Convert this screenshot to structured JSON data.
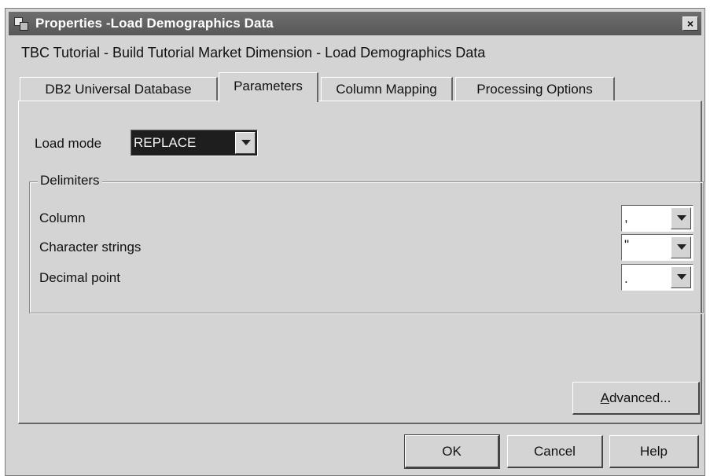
{
  "window": {
    "title": "Properties -Load Demographics Data",
    "close_glyph": "×",
    "subtitle": "TBC Tutorial - Build Tutorial Market Dimension - Load Demographics Data"
  },
  "tabs": [
    {
      "label": "DB2 Universal Database",
      "active": false
    },
    {
      "label": "Parameters",
      "active": true
    },
    {
      "label": "Column Mapping",
      "active": false
    },
    {
      "label": "Processing Options",
      "active": false
    }
  ],
  "parameters": {
    "load_mode_label": "Load mode",
    "load_mode_value": "REPLACE",
    "delimiters": {
      "title": "Delimiters",
      "column_label": "Column",
      "column_value": ",",
      "character_strings_label": "Character strings",
      "character_strings_value": "\"",
      "decimal_point_label": "Decimal point",
      "decimal_point_value": "."
    },
    "advanced_label_prefix": "",
    "advanced_label_access": "A",
    "advanced_label_rest": "dvanced..."
  },
  "buttons": {
    "ok": "OK",
    "cancel": "Cancel",
    "help": "Help"
  }
}
